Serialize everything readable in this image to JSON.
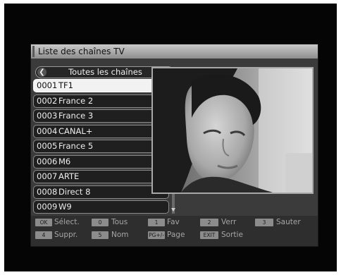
{
  "window": {
    "title": "Liste des chaînes TV"
  },
  "group": {
    "label": "Toutes les chaînes"
  },
  "channels": [
    {
      "num": "0001",
      "name": "TF1",
      "flag": "🗁"
    },
    {
      "num": "0002",
      "name": "France 2",
      "flag": ""
    },
    {
      "num": "0003",
      "name": "France 3",
      "flag": ""
    },
    {
      "num": "0004",
      "name": "CANAL+",
      "flag": "C"
    },
    {
      "num": "0005",
      "name": "France 5",
      "flag": ""
    },
    {
      "num": "0006",
      "name": "M6",
      "flag": ""
    },
    {
      "num": "0007",
      "name": "ARTE",
      "flag": ""
    },
    {
      "num": "0008",
      "name": "Direct 8",
      "flag": ""
    },
    {
      "num": "0009",
      "name": "W9",
      "flag": ""
    }
  ],
  "selected_channel": "0001 TF1",
  "help": {
    "ok_key": "OK",
    "ok_label": "Sélect.",
    "zero_key": "0",
    "zero_label": "Tous",
    "one_key": "1",
    "one_label": "Fav",
    "two_key": "2",
    "two_label": "Verr",
    "three_key": "3",
    "three_label": "Sauter",
    "four_key": "4",
    "four_label": "Suppr.",
    "five_key": "5",
    "five_label": "Nom",
    "page_key": "PG+/-",
    "page_label": "Page",
    "exit_key": "EXIT",
    "exit_label": "Sortie"
  },
  "colors": {
    "screen_bg": "#050505",
    "panel_bg": "#3b3b3b",
    "selected_bg": "#f2f2f2",
    "key_bg": "#8c8c8c"
  },
  "icons": {
    "left_arrow": "chevron-left-icon",
    "right_arrow": "chevron-right-icon",
    "folder": "folder-icon"
  }
}
